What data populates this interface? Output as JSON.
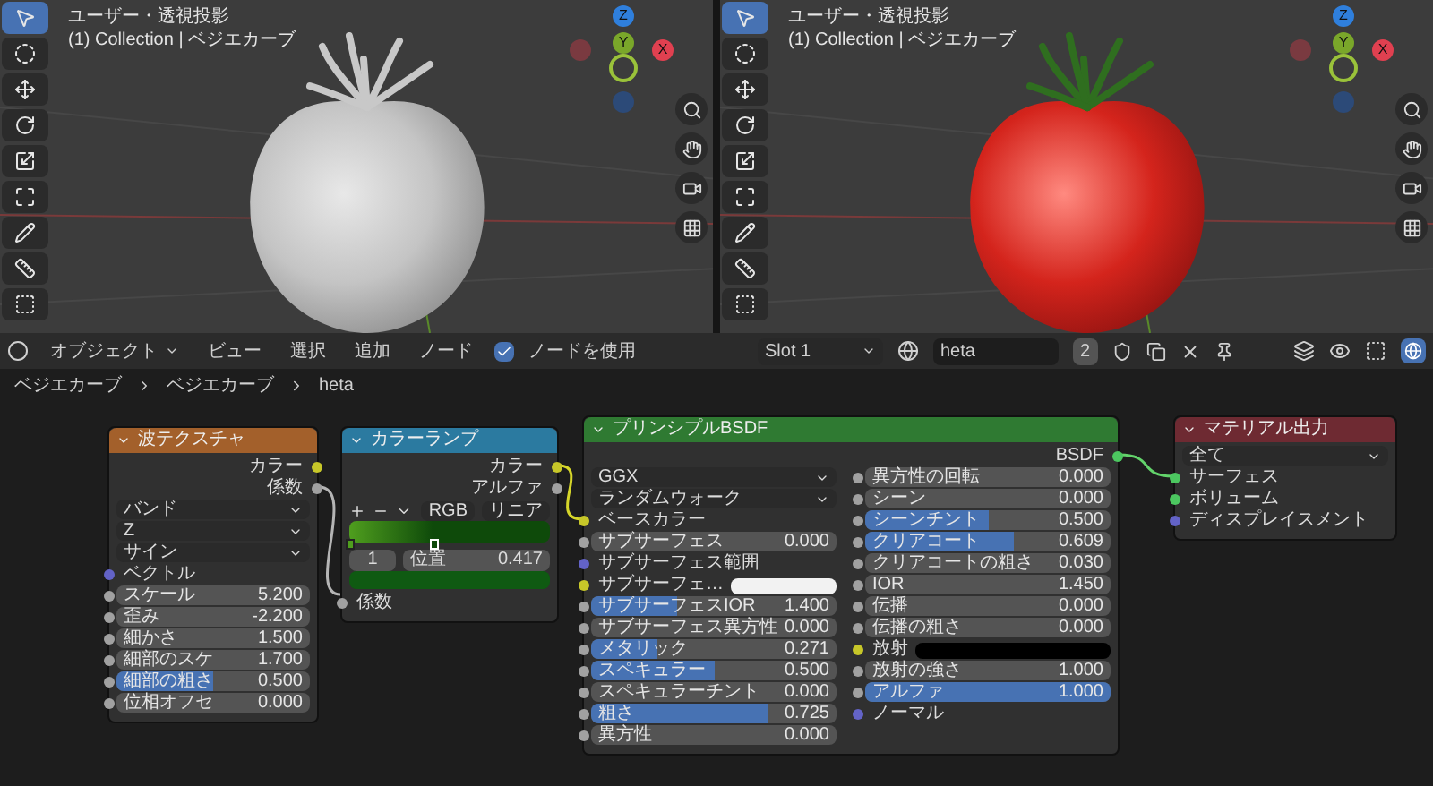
{
  "viewports": [
    {
      "kind": "solid",
      "title": "ユーザー・透視投影",
      "subtitle": "(1) Collection | ベジエカーブ",
      "gizmo": {
        "z": "Z",
        "y": "Y",
        "x": "X"
      },
      "tools": [
        {
          "kind": "select",
          "selected": true
        },
        {
          "kind": "cursor",
          "selected": false
        },
        {
          "kind": "move",
          "selected": false
        },
        {
          "kind": "rotate",
          "selected": false
        },
        {
          "kind": "scale",
          "selected": false
        },
        {
          "kind": "transform",
          "selected": false
        },
        {
          "kind": "annotate",
          "selected": false
        },
        {
          "kind": "measure",
          "selected": false
        },
        {
          "kind": "add",
          "selected": false
        }
      ]
    },
    {
      "kind": "material",
      "title": "ユーザー・透視投影",
      "subtitle": "(1) Collection | ベジエカーブ",
      "gizmo": {
        "z": "Z",
        "y": "Y",
        "x": "X"
      },
      "tools": [
        {
          "kind": "select",
          "selected": true
        },
        {
          "kind": "cursor",
          "selected": false
        },
        {
          "kind": "move",
          "selected": false
        },
        {
          "kind": "rotate",
          "selected": false
        },
        {
          "kind": "scale",
          "selected": false
        },
        {
          "kind": "transform",
          "selected": false
        },
        {
          "kind": "annotate",
          "selected": false
        },
        {
          "kind": "measure",
          "selected": false
        },
        {
          "kind": "add",
          "selected": false
        }
      ]
    }
  ],
  "header": {
    "mode": "オブジェクト",
    "menus": [
      "ビュー",
      "選択",
      "追加",
      "ノード"
    ],
    "use_nodes": {
      "label": "ノードを使用",
      "checked": true
    },
    "slot": "Slot 1",
    "material": "heta",
    "users": "2"
  },
  "breadcrumb": [
    "ベジエカーブ",
    "ベジエカーブ",
    "heta"
  ],
  "nodes": [
    {
      "kind": "wave",
      "title": "波テクスチャ",
      "color": "#a3602b",
      "rows": [
        {
          "kind": "output",
          "label": "カラー",
          "socket": {
            "color": "#c7c729"
          }
        },
        {
          "kind": "output",
          "label": "係数",
          "socket": {
            "color": "#a1a1a1"
          }
        },
        {
          "kind": "dropdown",
          "value": "バンド"
        },
        {
          "kind": "dropdown",
          "value": "Z"
        },
        {
          "kind": "dropdown",
          "value": "サイン"
        },
        {
          "kind": "input",
          "label": "ベクトル",
          "socket": {
            "color": "#6363c7"
          }
        },
        {
          "kind": "number",
          "label": "スケール",
          "value": "5.200",
          "socket": {
            "color": "#a1a1a1"
          }
        },
        {
          "kind": "number",
          "label": "歪み",
          "value": "-2.200",
          "socket": {
            "color": "#a1a1a1"
          }
        },
        {
          "kind": "number",
          "label": "細かさ",
          "value": "1.500",
          "socket": {
            "color": "#a1a1a1"
          }
        },
        {
          "kind": "number",
          "label": "細部のスケ",
          "value": "1.700",
          "socket": {
            "color": "#a1a1a1"
          }
        },
        {
          "kind": "slider",
          "label": "細部の粗さ",
          "value": "0.500",
          "level": 0.5,
          "socket": {
            "color": "#a1a1a1"
          }
        },
        {
          "kind": "number",
          "label": "位相オフセ",
          "value": "0.000",
          "socket": {
            "color": "#a1a1a1"
          }
        }
      ]
    },
    {
      "kind": "ramp",
      "title": "カラーランプ",
      "color": "#2b7aa0",
      "rows": [
        {
          "kind": "output",
          "label": "カラー",
          "socket": {
            "color": "#c7c729"
          }
        },
        {
          "kind": "output",
          "label": "アルファ",
          "socket": {
            "color": "#a1a1a1"
          }
        },
        {
          "kind": "ramp_controls",
          "color_mode": "RGB",
          "interpolation": "リニア"
        },
        {
          "kind": "ramp",
          "stops": [
            {
              "level": 0,
              "color": "#4f9e1e",
              "selected": false
            },
            {
              "level": 0.417,
              "color": "#0e4a0a",
              "selected": true
            }
          ]
        },
        {
          "kind": "ramp_stop",
          "index": "1",
          "label": "位置",
          "value": "0.417"
        },
        {
          "kind": "swatch",
          "color": "#0f5a12"
        },
        {
          "kind": "input",
          "label": "係数",
          "socket": {
            "color": "#a1a1a1"
          }
        }
      ]
    },
    {
      "kind": "principled",
      "title": "プリンシプルBSDF",
      "color": "#2f7a32",
      "rows": [
        {
          "kind": "output",
          "label": "BSDF",
          "socket": {
            "color": "#4cc760"
          }
        },
        {
          "kind": "dropdown",
          "value": "GGX"
        },
        {
          "kind": "dropdown",
          "value": "ランダムウォーク"
        },
        {
          "kind": "input",
          "label": "ベースカラー",
          "socket": {
            "color": "#c7c729"
          }
        },
        {
          "kind": "number",
          "label": "サブサーフェス",
          "value": "0.000",
          "socket": {
            "color": "#a1a1a1"
          }
        },
        {
          "kind": "input",
          "label": "サブサーフェス範囲",
          "socket": {
            "color": "#6363c7"
          }
        },
        {
          "kind": "color",
          "label": "サブサーフェ…",
          "color": "#f2f2f2",
          "socket": {
            "color": "#c7c729"
          }
        },
        {
          "kind": "slider",
          "label": "サブサーフェスIOR",
          "value": "1.400",
          "level": 0.35,
          "socket": {
            "color": "#a1a1a1"
          }
        },
        {
          "kind": "number",
          "label": "サブサーフェス異方性",
          "value": "0.000",
          "socket": {
            "color": "#a1a1a1"
          }
        },
        {
          "kind": "slider",
          "label": "メタリック",
          "value": "0.271",
          "level": 0.271,
          "socket": {
            "color": "#a1a1a1"
          }
        },
        {
          "kind": "slider",
          "label": "スペキュラー",
          "value": "0.500",
          "level": 0.5,
          "socket": {
            "color": "#a1a1a1"
          }
        },
        {
          "kind": "number",
          "label": "スペキュラーチント",
          "value": "0.000",
          "socket": {
            "color": "#a1a1a1"
          }
        },
        {
          "kind": "slider",
          "label": "粗さ",
          "value": "0.725",
          "level": 0.725,
          "socket": {
            "color": "#a1a1a1"
          }
        },
        {
          "kind": "number",
          "label": "異方性",
          "value": "0.000",
          "socket": {
            "color": "#a1a1a1"
          }
        },
        {
          "kind": "number",
          "label": "異方性の回転",
          "value": "0.000",
          "socket": {
            "color": "#a1a1a1"
          }
        },
        {
          "kind": "number",
          "label": "シーン",
          "value": "0.000",
          "socket": {
            "color": "#a1a1a1"
          }
        },
        {
          "kind": "slider",
          "label": "シーンチント",
          "value": "0.500",
          "level": 0.5,
          "socket": {
            "color": "#a1a1a1"
          }
        },
        {
          "kind": "slider",
          "label": "クリアコート",
          "value": "0.609",
          "level": 0.609,
          "socket": {
            "color": "#a1a1a1"
          }
        },
        {
          "kind": "number",
          "label": "クリアコートの粗さ",
          "value": "0.030",
          "socket": {
            "color": "#a1a1a1"
          }
        },
        {
          "kind": "number",
          "label": "IOR",
          "value": "1.450",
          "socket": {
            "color": "#a1a1a1"
          }
        },
        {
          "kind": "number",
          "label": "伝播",
          "value": "0.000",
          "socket": {
            "color": "#a1a1a1"
          }
        },
        {
          "kind": "number",
          "label": "伝播の粗さ",
          "value": "0.000",
          "socket": {
            "color": "#a1a1a1"
          }
        },
        {
          "kind": "color",
          "label": "放射",
          "color": "#000000",
          "socket": {
            "color": "#c7c729"
          }
        },
        {
          "kind": "number",
          "label": "放射の強さ",
          "value": "1.000",
          "socket": {
            "color": "#a1a1a1"
          }
        },
        {
          "kind": "slider",
          "label": "アルファ",
          "value": "1.000",
          "level": 1,
          "socket": {
            "color": "#a1a1a1"
          }
        },
        {
          "kind": "input",
          "label": "ノーマル",
          "socket": {
            "color": "#6363c7"
          }
        }
      ]
    },
    {
      "kind": "output",
      "title": "マテリアル出力",
      "color": "#6e2a32",
      "rows": [
        {
          "kind": "dropdown",
          "value": "全て"
        },
        {
          "kind": "input",
          "label": "サーフェス",
          "socket": {
            "color": "#4cc760"
          }
        },
        {
          "kind": "input",
          "label": "ボリューム",
          "socket": {
            "color": "#4cc760"
          }
        },
        {
          "kind": "input",
          "label": "ディスプレイスメント",
          "socket": {
            "color": "#6363c7"
          }
        }
      ]
    }
  ]
}
